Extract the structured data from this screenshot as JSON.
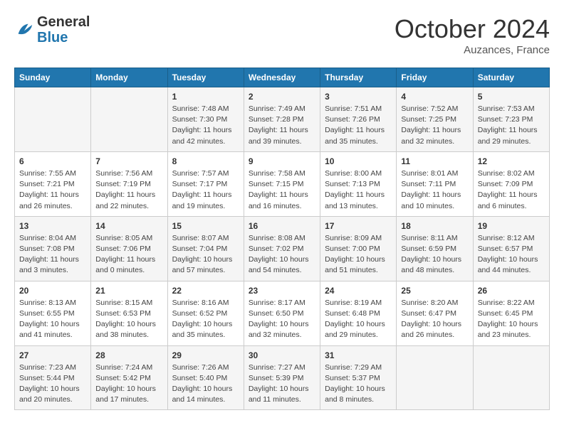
{
  "header": {
    "logo_general": "General",
    "logo_blue": "Blue",
    "month_title": "October 2024",
    "subtitle": "Auzances, France"
  },
  "days_of_week": [
    "Sunday",
    "Monday",
    "Tuesday",
    "Wednesday",
    "Thursday",
    "Friday",
    "Saturday"
  ],
  "weeks": [
    [
      {
        "day": "",
        "sunrise": "",
        "sunset": "",
        "daylight": ""
      },
      {
        "day": "",
        "sunrise": "",
        "sunset": "",
        "daylight": ""
      },
      {
        "day": "1",
        "sunrise": "Sunrise: 7:48 AM",
        "sunset": "Sunset: 7:30 PM",
        "daylight": "Daylight: 11 hours and 42 minutes."
      },
      {
        "day": "2",
        "sunrise": "Sunrise: 7:49 AM",
        "sunset": "Sunset: 7:28 PM",
        "daylight": "Daylight: 11 hours and 39 minutes."
      },
      {
        "day": "3",
        "sunrise": "Sunrise: 7:51 AM",
        "sunset": "Sunset: 7:26 PM",
        "daylight": "Daylight: 11 hours and 35 minutes."
      },
      {
        "day": "4",
        "sunrise": "Sunrise: 7:52 AM",
        "sunset": "Sunset: 7:25 PM",
        "daylight": "Daylight: 11 hours and 32 minutes."
      },
      {
        "day": "5",
        "sunrise": "Sunrise: 7:53 AM",
        "sunset": "Sunset: 7:23 PM",
        "daylight": "Daylight: 11 hours and 29 minutes."
      }
    ],
    [
      {
        "day": "6",
        "sunrise": "Sunrise: 7:55 AM",
        "sunset": "Sunset: 7:21 PM",
        "daylight": "Daylight: 11 hours and 26 minutes."
      },
      {
        "day": "7",
        "sunrise": "Sunrise: 7:56 AM",
        "sunset": "Sunset: 7:19 PM",
        "daylight": "Daylight: 11 hours and 22 minutes."
      },
      {
        "day": "8",
        "sunrise": "Sunrise: 7:57 AM",
        "sunset": "Sunset: 7:17 PM",
        "daylight": "Daylight: 11 hours and 19 minutes."
      },
      {
        "day": "9",
        "sunrise": "Sunrise: 7:58 AM",
        "sunset": "Sunset: 7:15 PM",
        "daylight": "Daylight: 11 hours and 16 minutes."
      },
      {
        "day": "10",
        "sunrise": "Sunrise: 8:00 AM",
        "sunset": "Sunset: 7:13 PM",
        "daylight": "Daylight: 11 hours and 13 minutes."
      },
      {
        "day": "11",
        "sunrise": "Sunrise: 8:01 AM",
        "sunset": "Sunset: 7:11 PM",
        "daylight": "Daylight: 11 hours and 10 minutes."
      },
      {
        "day": "12",
        "sunrise": "Sunrise: 8:02 AM",
        "sunset": "Sunset: 7:09 PM",
        "daylight": "Daylight: 11 hours and 6 minutes."
      }
    ],
    [
      {
        "day": "13",
        "sunrise": "Sunrise: 8:04 AM",
        "sunset": "Sunset: 7:08 PM",
        "daylight": "Daylight: 11 hours and 3 minutes."
      },
      {
        "day": "14",
        "sunrise": "Sunrise: 8:05 AM",
        "sunset": "Sunset: 7:06 PM",
        "daylight": "Daylight: 11 hours and 0 minutes."
      },
      {
        "day": "15",
        "sunrise": "Sunrise: 8:07 AM",
        "sunset": "Sunset: 7:04 PM",
        "daylight": "Daylight: 10 hours and 57 minutes."
      },
      {
        "day": "16",
        "sunrise": "Sunrise: 8:08 AM",
        "sunset": "Sunset: 7:02 PM",
        "daylight": "Daylight: 10 hours and 54 minutes."
      },
      {
        "day": "17",
        "sunrise": "Sunrise: 8:09 AM",
        "sunset": "Sunset: 7:00 PM",
        "daylight": "Daylight: 10 hours and 51 minutes."
      },
      {
        "day": "18",
        "sunrise": "Sunrise: 8:11 AM",
        "sunset": "Sunset: 6:59 PM",
        "daylight": "Daylight: 10 hours and 48 minutes."
      },
      {
        "day": "19",
        "sunrise": "Sunrise: 8:12 AM",
        "sunset": "Sunset: 6:57 PM",
        "daylight": "Daylight: 10 hours and 44 minutes."
      }
    ],
    [
      {
        "day": "20",
        "sunrise": "Sunrise: 8:13 AM",
        "sunset": "Sunset: 6:55 PM",
        "daylight": "Daylight: 10 hours and 41 minutes."
      },
      {
        "day": "21",
        "sunrise": "Sunrise: 8:15 AM",
        "sunset": "Sunset: 6:53 PM",
        "daylight": "Daylight: 10 hours and 38 minutes."
      },
      {
        "day": "22",
        "sunrise": "Sunrise: 8:16 AM",
        "sunset": "Sunset: 6:52 PM",
        "daylight": "Daylight: 10 hours and 35 minutes."
      },
      {
        "day": "23",
        "sunrise": "Sunrise: 8:17 AM",
        "sunset": "Sunset: 6:50 PM",
        "daylight": "Daylight: 10 hours and 32 minutes."
      },
      {
        "day": "24",
        "sunrise": "Sunrise: 8:19 AM",
        "sunset": "Sunset: 6:48 PM",
        "daylight": "Daylight: 10 hours and 29 minutes."
      },
      {
        "day": "25",
        "sunrise": "Sunrise: 8:20 AM",
        "sunset": "Sunset: 6:47 PM",
        "daylight": "Daylight: 10 hours and 26 minutes."
      },
      {
        "day": "26",
        "sunrise": "Sunrise: 8:22 AM",
        "sunset": "Sunset: 6:45 PM",
        "daylight": "Daylight: 10 hours and 23 minutes."
      }
    ],
    [
      {
        "day": "27",
        "sunrise": "Sunrise: 7:23 AM",
        "sunset": "Sunset: 5:44 PM",
        "daylight": "Daylight: 10 hours and 20 minutes."
      },
      {
        "day": "28",
        "sunrise": "Sunrise: 7:24 AM",
        "sunset": "Sunset: 5:42 PM",
        "daylight": "Daylight: 10 hours and 17 minutes."
      },
      {
        "day": "29",
        "sunrise": "Sunrise: 7:26 AM",
        "sunset": "Sunset: 5:40 PM",
        "daylight": "Daylight: 10 hours and 14 minutes."
      },
      {
        "day": "30",
        "sunrise": "Sunrise: 7:27 AM",
        "sunset": "Sunset: 5:39 PM",
        "daylight": "Daylight: 10 hours and 11 minutes."
      },
      {
        "day": "31",
        "sunrise": "Sunrise: 7:29 AM",
        "sunset": "Sunset: 5:37 PM",
        "daylight": "Daylight: 10 hours and 8 minutes."
      },
      {
        "day": "",
        "sunrise": "",
        "sunset": "",
        "daylight": ""
      },
      {
        "day": "",
        "sunrise": "",
        "sunset": "",
        "daylight": ""
      }
    ]
  ]
}
